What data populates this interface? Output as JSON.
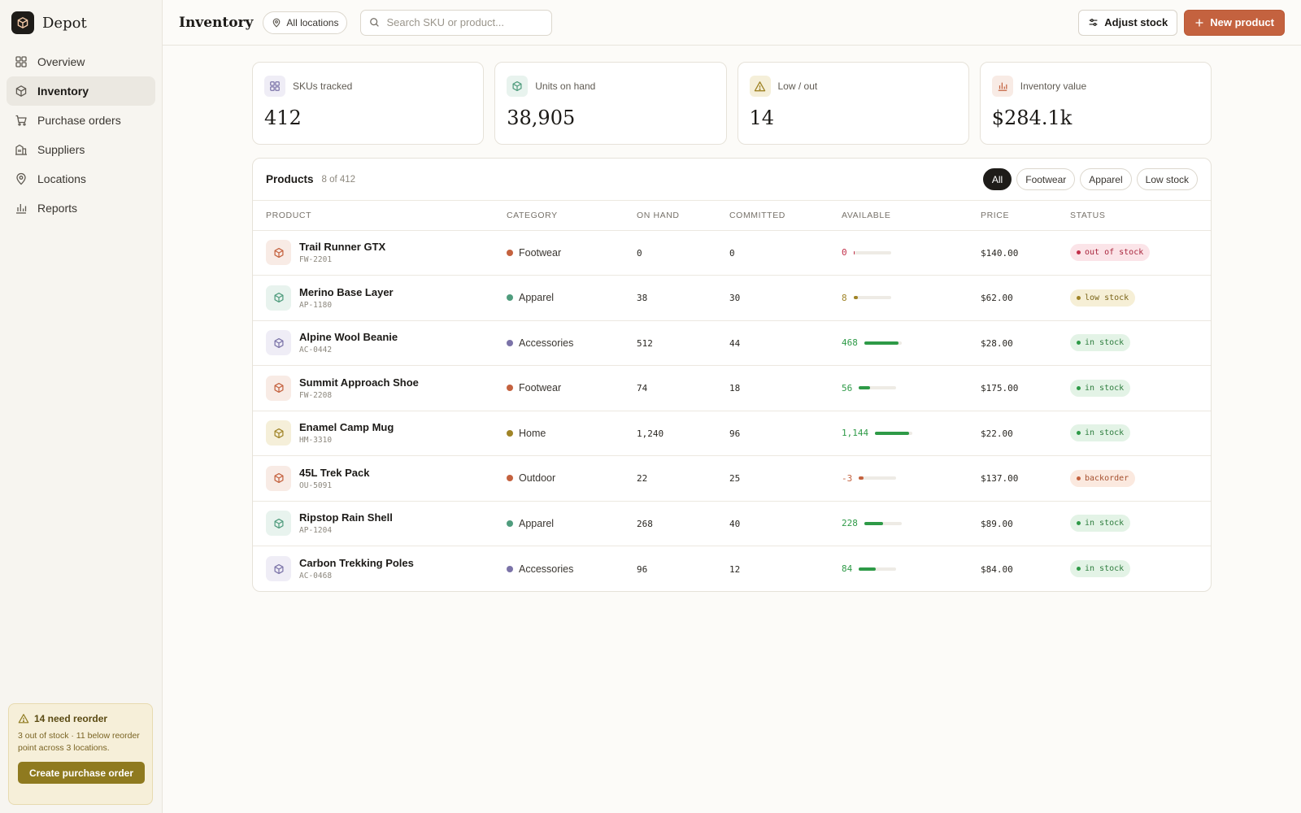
{
  "brand": {
    "name": "Depot"
  },
  "sidebar": {
    "items": [
      {
        "label": "Overview",
        "icon": "grid-icon"
      },
      {
        "label": "Inventory",
        "icon": "box-icon",
        "active": true
      },
      {
        "label": "Purchase orders",
        "icon": "cart-icon"
      },
      {
        "label": "Suppliers",
        "icon": "building-icon"
      },
      {
        "label": "Locations",
        "icon": "pin-icon"
      },
      {
        "label": "Reports",
        "icon": "bar-chart-icon"
      }
    ],
    "reorder": {
      "title": "14 need reorder",
      "text": "3 out of stock · 11 below reorder point across 3 locations.",
      "button": "Create purchase order"
    }
  },
  "header": {
    "title": "Inventory",
    "location_filter": "All locations",
    "search_placeholder": "Search SKU or product...",
    "adjust_label": "Adjust stock",
    "new_label": "New product"
  },
  "stats": [
    {
      "label": "SKUs tracked",
      "value": "412",
      "icon": "grid-icon",
      "tint": "#efedf6",
      "color": "#7b73a8"
    },
    {
      "label": "Units on hand",
      "value": "38,905",
      "icon": "box-icon",
      "tint": "#e8f3ee",
      "color": "#4f9c7d"
    },
    {
      "label": "Low / out",
      "value": "14",
      "icon": "warning-icon",
      "tint": "#f5efd9",
      "color": "#a08427"
    },
    {
      "label": "Inventory value",
      "value": "$284.1k",
      "icon": "bar-chart-icon",
      "tint": "#f8ebe5",
      "color": "#c4623f"
    }
  ],
  "products": {
    "title": "Products",
    "count": "8 of 412",
    "filters": [
      {
        "label": "All",
        "active": true
      },
      {
        "label": "Footwear"
      },
      {
        "label": "Apparel"
      },
      {
        "label": "Low stock"
      }
    ],
    "columns": [
      "PRODUCT",
      "CATEGORY",
      "ON HAND",
      "COMMITTED",
      "AVAILABLE",
      "PRICE",
      "STATUS"
    ],
    "rows": [
      {
        "name": "Trail Runner GTX",
        "sku": "FW-2201",
        "category": "Footwear",
        "on_hand": "0",
        "committed": "0",
        "available": "0",
        "available_fraction": 0.02,
        "price": "$140.00",
        "status": "out of stock",
        "status_kind": "out"
      },
      {
        "name": "Merino Base Layer",
        "sku": "AP-1180",
        "category": "Apparel",
        "on_hand": "38",
        "committed": "30",
        "available": "8",
        "available_fraction": 0.12,
        "price": "$62.00",
        "status": "low stock",
        "status_kind": "low"
      },
      {
        "name": "Alpine Wool Beanie",
        "sku": "AC-0442",
        "category": "Accessories",
        "on_hand": "512",
        "committed": "44",
        "available": "468",
        "available_fraction": 0.91,
        "price": "$28.00",
        "status": "in stock",
        "status_kind": "in"
      },
      {
        "name": "Summit Approach Shoe",
        "sku": "FW-2208",
        "category": "Footwear",
        "on_hand": "74",
        "committed": "18",
        "available": "56",
        "available_fraction": 0.3,
        "price": "$175.00",
        "status": "in stock",
        "status_kind": "in"
      },
      {
        "name": "Enamel Camp Mug",
        "sku": "HM-3310",
        "category": "Home",
        "on_hand": "1,240",
        "committed": "96",
        "available": "1,144",
        "available_fraction": 0.92,
        "price": "$22.00",
        "status": "in stock",
        "status_kind": "in"
      },
      {
        "name": "45L Trek Pack",
        "sku": "OU-5091",
        "category": "Outdoor",
        "on_hand": "22",
        "committed": "25",
        "available": "-3",
        "available_fraction": 0.12,
        "price": "$137.00",
        "status": "backorder",
        "status_kind": "back"
      },
      {
        "name": "Ripstop Rain Shell",
        "sku": "AP-1204",
        "category": "Apparel",
        "on_hand": "268",
        "committed": "40",
        "available": "228",
        "available_fraction": 0.5,
        "price": "$89.00",
        "status": "in stock",
        "status_kind": "in"
      },
      {
        "name": "Carbon Trekking Poles",
        "sku": "AC-0468",
        "category": "Accessories",
        "on_hand": "96",
        "committed": "12",
        "available": "84",
        "available_fraction": 0.45,
        "price": "$84.00",
        "status": "in stock",
        "status_kind": "in"
      }
    ]
  },
  "colors": {
    "accent": "#c4623f",
    "footwear": "#c4623f",
    "apparel": "#4f9c7d",
    "accessories": "#7b73a8",
    "home": "#a08427",
    "outdoor": "#c4623f",
    "in_stock": "#2e9a47",
    "low_stock": "#a08427",
    "out_of_stock": "#c2304a",
    "backorder": "#c4623f"
  }
}
